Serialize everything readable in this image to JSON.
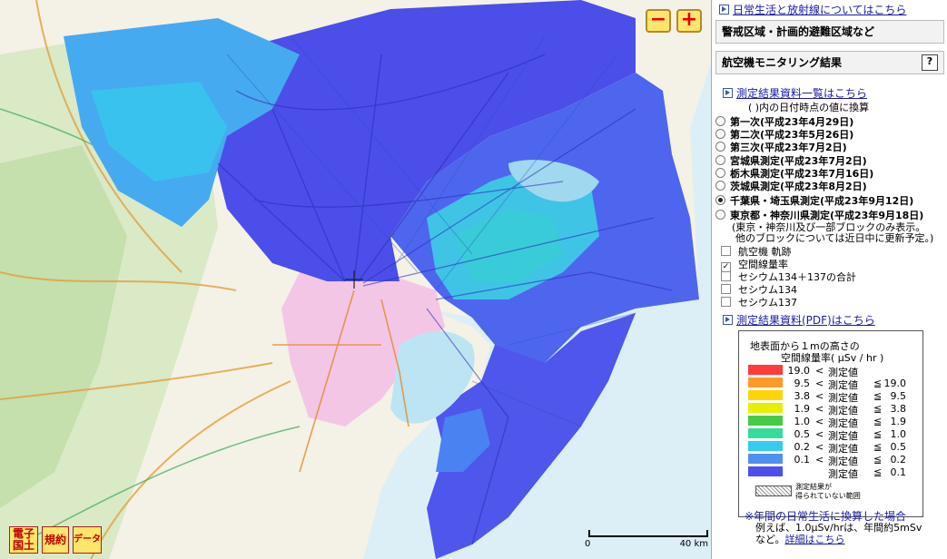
{
  "map": {
    "zoom_out": "−",
    "zoom_in": "+",
    "scale": {
      "start": "0",
      "end": "40 km"
    },
    "buttons": [
      {
        "label": "電子\n国土"
      },
      {
        "label": "規約"
      },
      {
        "label": "データ"
      }
    ]
  },
  "panel": {
    "top_link": "日常生活と放射線についてはこちら",
    "section1": "警戒区域・計画的避難区域など",
    "section2": "航空機モニタリング結果",
    "help": "?",
    "results_link": "測定結果資料一覧はこちら",
    "note": "( )内の日付時点の値に換算",
    "surveys": [
      {
        "label": "第一次(平成23年4月29日)",
        "selected": false
      },
      {
        "label": "第二次(平成23年5月26日)",
        "selected": false
      },
      {
        "label": "第三次(平成23年7月2日)",
        "selected": false
      },
      {
        "label": "宮城県測定(平成23年7月2日)",
        "selected": false
      },
      {
        "label": "栃木県測定(平成23年7月16日)",
        "selected": false
      },
      {
        "label": "茨城県測定(平成23年8月2日)",
        "selected": false
      },
      {
        "label": "千葉県・埼玉県測定(平成23年9月12日)",
        "selected": true
      },
      {
        "label": "東京都・神奈川県測定(平成23年9月18日)",
        "selected": false
      }
    ],
    "survey_note1": "(東京・神奈川及び一部ブロックのみ表示。",
    "survey_note2": "他のブロックについては近日中に更新予定。)",
    "layers": [
      {
        "label": "航空機 軌跡",
        "checked": false
      },
      {
        "label": "空間線量率",
        "checked": true
      },
      {
        "label": "セシウム134＋137の合計",
        "checked": false
      },
      {
        "label": "セシウム134",
        "checked": false
      },
      {
        "label": "セシウム137",
        "checked": false
      }
    ],
    "pdf_link": "測定結果資料(PDF)はこちら",
    "legend": {
      "title1": "地表面から１mの高さの",
      "title2": "空間線量率( μSv / hr )",
      "rows": [
        {
          "color": "#ff3b3b",
          "v1": "19.0",
          "op1": "<",
          "mid": "測定値",
          "op2": "",
          "v2": ""
        },
        {
          "color": "#ff9a2a",
          "v1": "9.5",
          "op1": "<",
          "mid": "測定値",
          "op2": "≦",
          "v2": "19.0"
        },
        {
          "color": "#ffd400",
          "v1": "3.8",
          "op1": "<",
          "mid": "測定値",
          "op2": "≦",
          "v2": "9.5"
        },
        {
          "color": "#e7f000",
          "v1": "1.9",
          "op1": "<",
          "mid": "測定値",
          "op2": "≦",
          "v2": "3.8"
        },
        {
          "color": "#44cc44",
          "v1": "1.0",
          "op1": "<",
          "mid": "測定値",
          "op2": "≦",
          "v2": "1.9"
        },
        {
          "color": "#33dd99",
          "v1": "0.5",
          "op1": "<",
          "mid": "測定値",
          "op2": "≦",
          "v2": "1.0"
        },
        {
          "color": "#33ccee",
          "v1": "0.2",
          "op1": "<",
          "mid": "測定値",
          "op2": "≦",
          "v2": "0.5"
        },
        {
          "color": "#4f8ff0",
          "v1": "0.1",
          "op1": "<",
          "mid": "測定値",
          "op2": "≦",
          "v2": "0.2"
        },
        {
          "color": "#4d4df0",
          "v1": "",
          "op1": "",
          "mid": "測定値",
          "op2": "≦",
          "v2": "0.1"
        }
      ],
      "nodata1": "測定結果が",
      "nodata2": "得られていない範囲"
    },
    "footer1": "※年間の日常生活に換算した場合",
    "footer2": "例えば、1.0μSv/hrは、年間約5mSv",
    "footer3": "など。",
    "footer_link": "詳細はこちら"
  }
}
